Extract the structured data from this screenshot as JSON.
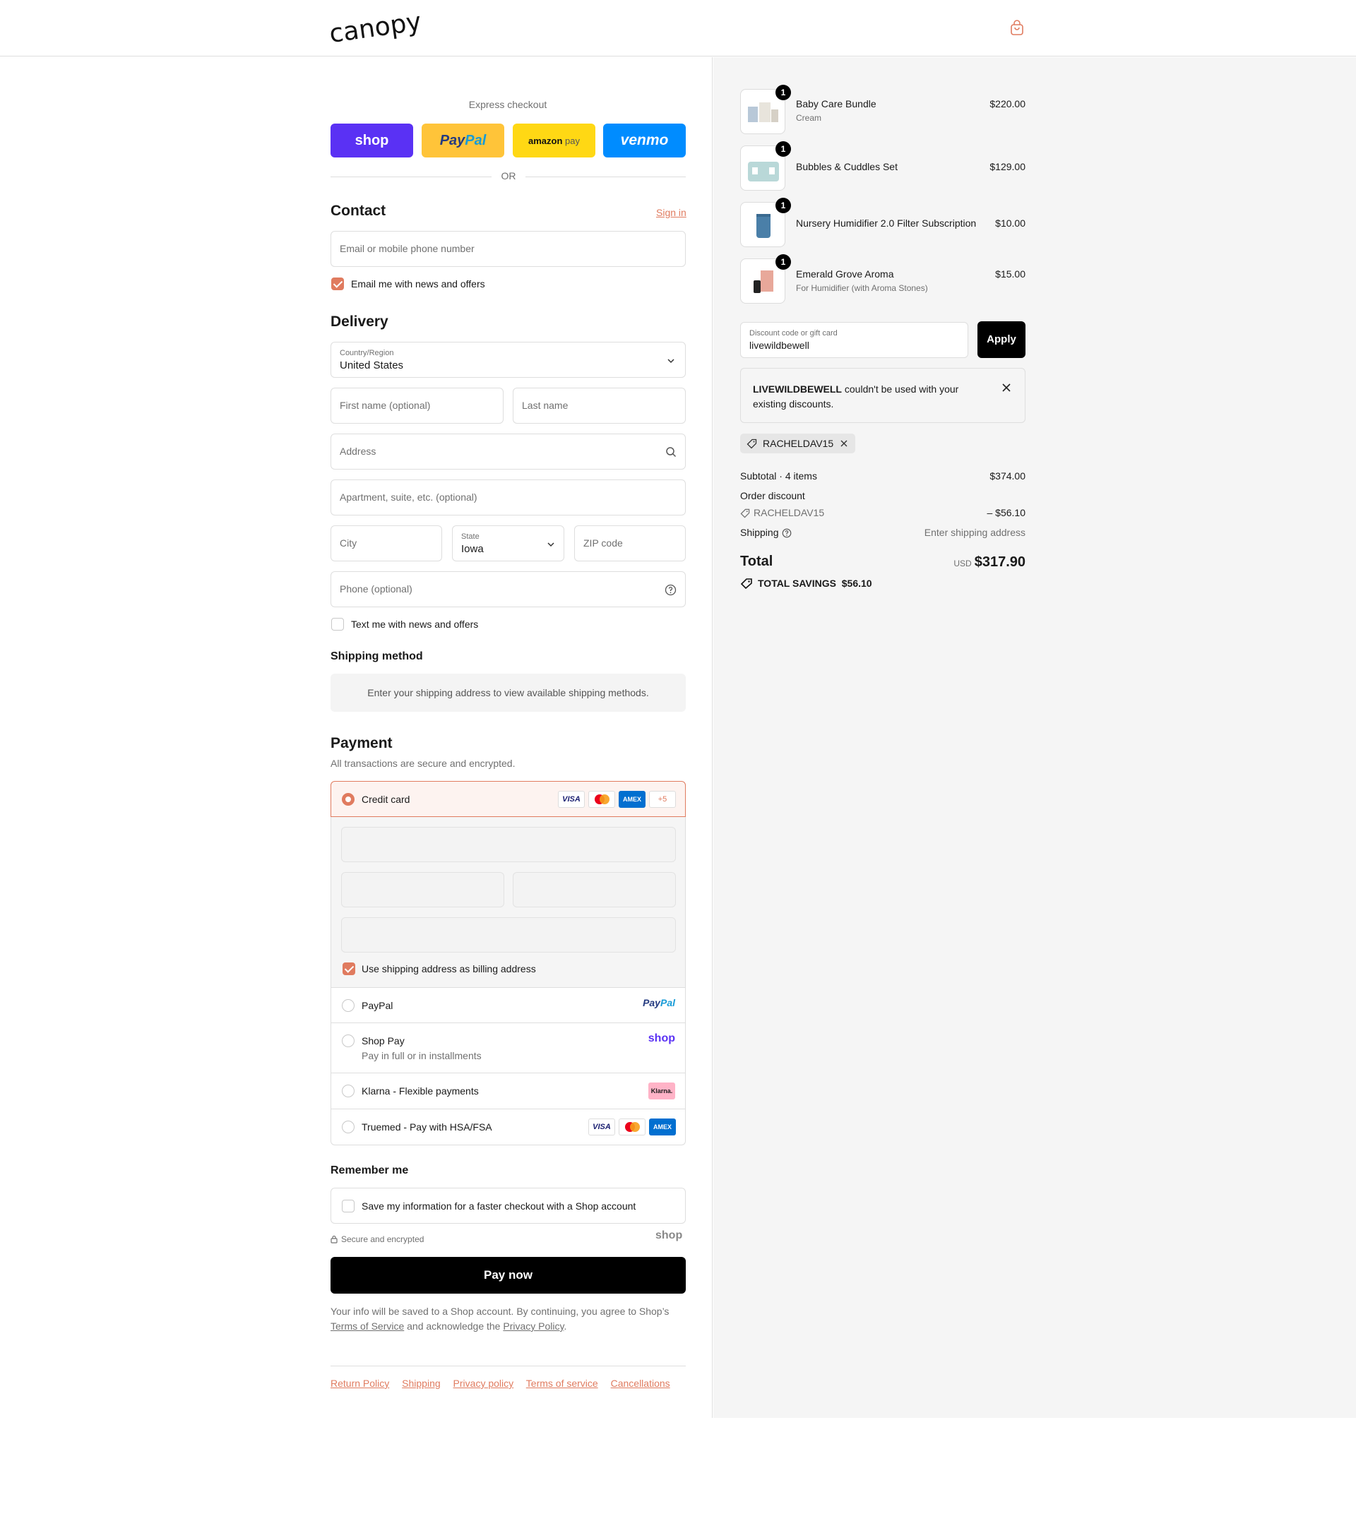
{
  "header": {
    "logo": "canopy"
  },
  "express": {
    "label": "Express checkout",
    "shop": "shop",
    "paypal_pay": "Pay",
    "paypal_pal": "Pal",
    "amazon": "amazon",
    "amazon_pay": "pay",
    "venmo": "venmo",
    "or": "OR"
  },
  "contact": {
    "title": "Contact",
    "sign_in": "Sign in",
    "email_placeholder": "Email or mobile phone number",
    "news_label": "Email me with news and offers"
  },
  "delivery": {
    "title": "Delivery",
    "country_label": "Country/Region",
    "country_value": "United States",
    "first_name": "First name (optional)",
    "last_name": "Last name",
    "address": "Address",
    "apartment": "Apartment, suite, etc. (optional)",
    "city": "City",
    "state_label": "State",
    "state_value": "Iowa",
    "zip": "ZIP code",
    "phone": "Phone (optional)",
    "text_label": "Text me with news and offers"
  },
  "shipping_method": {
    "title": "Shipping method",
    "note": "Enter your shipping address to view available shipping methods."
  },
  "payment": {
    "title": "Payment",
    "subtitle": "All transactions are secure and encrypted.",
    "credit_card": "Credit card",
    "more_cards": "+5",
    "visa": "VISA",
    "amex": "AMEX",
    "billing_label": "Use shipping address as billing address",
    "paypal": "PayPal",
    "shop_pay": "Shop Pay",
    "shop_pay_sub": "Pay in full or in installments",
    "klarna": "Klarna - Flexible payments",
    "klarna_logo": "Klarna.",
    "truemed": "Truemed - Pay with HSA/FSA",
    "shop_logo": "shop"
  },
  "remember": {
    "title": "Remember me",
    "save_label": "Save my information for a faster checkout with a Shop account",
    "secure": "Secure and encrypted",
    "shop": "shop"
  },
  "pay_now": "Pay now",
  "legal": {
    "line1": "Your info will be saved to a Shop account. By continuing, you agree to Shop’s",
    "tos": "Terms of Service",
    "mid": "and acknowledge the",
    "privacy": "Privacy Policy",
    "end": "."
  },
  "footer_links": [
    "Return Policy",
    "Shipping",
    "Privacy policy",
    "Terms of service",
    "Cancellations"
  ],
  "cart": {
    "items": [
      {
        "qty": "1",
        "name": "Baby Care Bundle",
        "variant": "Cream",
        "price": "$220.00"
      },
      {
        "qty": "1",
        "name": "Bubbles & Cuddles Set",
        "variant": "",
        "price": "$129.00"
      },
      {
        "qty": "1",
        "name": "Nursery Humidifier 2.0 Filter Subscription",
        "variant": "",
        "price": "$10.00"
      },
      {
        "qty": "1",
        "name": "Emerald Grove Aroma",
        "variant": "For Humidifier (with Aroma Stones)",
        "price": "$15.00"
      }
    ],
    "discount_label": "Discount code or gift card",
    "discount_value": "livewildbewell",
    "apply": "Apply",
    "error_code": "LIVEWILDBEWELL",
    "error_msg": "couldn't be used with your",
    "error_msg2": "existing discounts.",
    "applied_code": "RACHELDAV15",
    "subtotal_label": "Subtotal · 4 items",
    "subtotal": "$374.00",
    "order_discount": "Order discount",
    "discount_code": "RACHELDAV15",
    "discount_amount": "– $56.10",
    "shipping_label": "Shipping",
    "shipping_value": "Enter shipping address",
    "total_label": "Total",
    "currency": "USD",
    "total": "$317.90",
    "savings_label": "TOTAL SAVINGS",
    "savings": "$56.10"
  },
  "colors": {
    "accent": "#e07b5f",
    "shop_purple": "#5a31f4",
    "paypal_yellow": "#ffc439",
    "amazon_yellow": "#ffd814",
    "venmo_blue": "#008cff"
  }
}
